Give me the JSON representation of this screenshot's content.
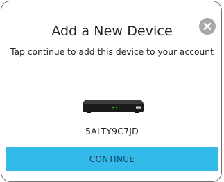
{
  "dialog": {
    "title": "Add a New Device",
    "subtitle": "Tap continue to add this device to your account",
    "close_icon": "close-circle-icon",
    "device_image": "dvr-recorder-image",
    "serial_number": "5ALTY9C7JD",
    "continue_label": "CONTINUE"
  },
  "colors": {
    "accent": "#33b9ea",
    "close_button": "#a9a9a9",
    "border": "#6f6f6f",
    "text": "#222222"
  }
}
